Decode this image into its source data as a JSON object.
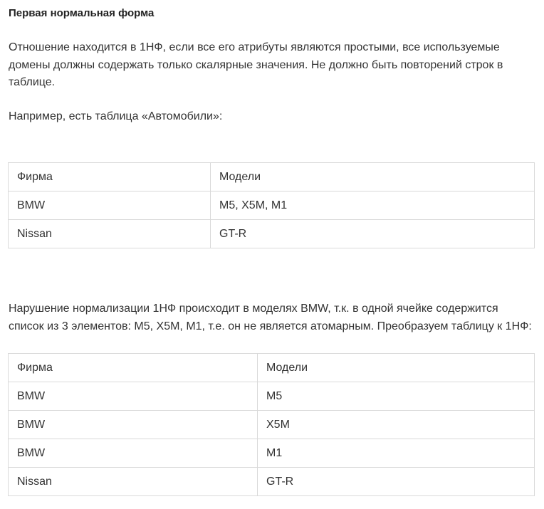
{
  "heading": "Первая нормальная форма",
  "paragraph1": "Отношение находится в 1НФ, если все его атрибуты являются простыми, все используемые домены должны содержать только скалярные значения. Не должно быть повторений строк в таблице.",
  "paragraph2": "Например, есть таблица «Автомобили»:",
  "table1": {
    "headers": [
      "Фирма",
      "Модели"
    ],
    "rows": [
      [
        "BMW",
        "M5, X5M, M1"
      ],
      [
        "Nissan",
        "GT-R"
      ]
    ]
  },
  "paragraph3": "Нарушение нормализации 1НФ происходит в моделях BMW, т.к. в одной ячейке содержится список из 3 элементов: M5, X5M, M1, т.е. он не является атомарным. Преобразуем таблицу к 1НФ:",
  "table2": {
    "headers": [
      "Фирма",
      "Модели"
    ],
    "rows": [
      [
        "BMW",
        "M5"
      ],
      [
        "BMW",
        "X5M"
      ],
      [
        "BMW",
        "M1"
      ],
      [
        "Nissan",
        "GT-R"
      ]
    ]
  }
}
